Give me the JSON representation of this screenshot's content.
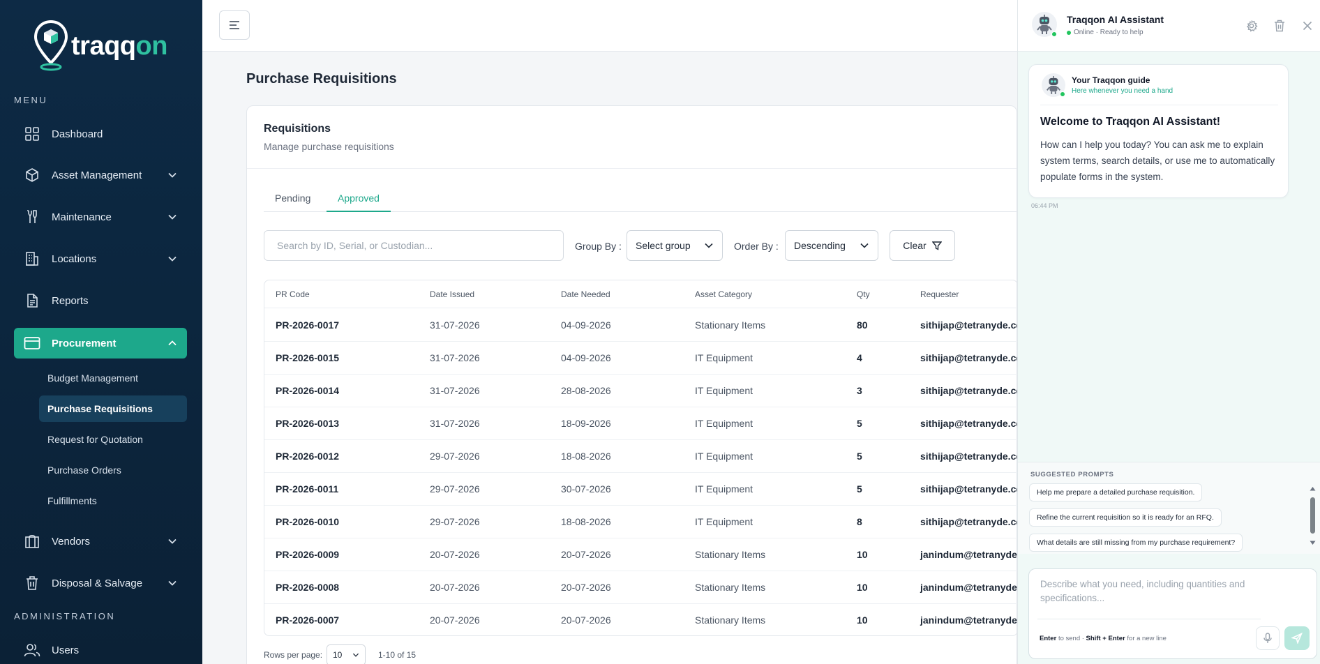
{
  "brand": {
    "name_main": "traqq",
    "name_accent": "on",
    "accent_color": "#2fc1a0",
    "sidebar_bg": "#0d2a45",
    "active_color": "#1da88b"
  },
  "sidebar": {
    "menu_label": "MENU",
    "admin_label": "ADMINISTRATION",
    "items": [
      {
        "label": "Dashboard",
        "icon": "grid-icon"
      },
      {
        "label": "Asset Management",
        "icon": "box-icon"
      },
      {
        "label": "Maintenance",
        "icon": "wrench-icon"
      },
      {
        "label": "Locations",
        "icon": "building-icon"
      },
      {
        "label": "Reports",
        "icon": "document-icon"
      },
      {
        "label": "Procurement",
        "icon": "card-icon"
      },
      {
        "label": "Vendors",
        "icon": "store-icon"
      },
      {
        "label": "Disposal & Salvage",
        "icon": "trash-icon"
      },
      {
        "label": "Users",
        "icon": "users-icon"
      }
    ],
    "procurement_sub": [
      "Budget Management",
      "Purchase Requisitions",
      "Request for Quotation",
      "Purchase Orders",
      "Fulfillments"
    ]
  },
  "page": {
    "title": "Purchase Requisitions",
    "card_title": "Requisitions",
    "card_subtitle": "Manage purchase requisitions",
    "tabs": [
      "Pending",
      "Approved"
    ],
    "active_tab": "Approved"
  },
  "filters": {
    "search_placeholder": "Search by ID, Serial, or Custodian...",
    "group_label": "Group By :",
    "group_value": "Select group",
    "order_label": "Order By :",
    "order_value": "Descending",
    "clear_label": "Clear"
  },
  "table": {
    "headers": [
      "PR Code",
      "Date Issued",
      "Date Needed",
      "Asset Category",
      "Qty",
      "Requester"
    ],
    "rows": [
      [
        "PR-2026-0017",
        "31-07-2026",
        "04-09-2026",
        "Stationary Items",
        "80",
        "sithijap@tetranyde.com"
      ],
      [
        "PR-2026-0015",
        "31-07-2026",
        "04-09-2026",
        "IT Equipment",
        "4",
        "sithijap@tetranyde.com"
      ],
      [
        "PR-2026-0014",
        "31-07-2026",
        "28-08-2026",
        "IT Equipment",
        "3",
        "sithijap@tetranyde.com"
      ],
      [
        "PR-2026-0013",
        "31-07-2026",
        "18-09-2026",
        "IT Equipment",
        "5",
        "sithijap@tetranyde.com"
      ],
      [
        "PR-2026-0012",
        "29-07-2026",
        "18-08-2026",
        "IT Equipment",
        "5",
        "sithijap@tetranyde.com"
      ],
      [
        "PR-2026-0011",
        "29-07-2026",
        "30-07-2026",
        "IT Equipment",
        "5",
        "sithijap@tetranyde.com"
      ],
      [
        "PR-2026-0010",
        "29-07-2026",
        "18-08-2026",
        "IT Equipment",
        "8",
        "sithijap@tetranyde.com"
      ],
      [
        "PR-2026-0009",
        "20-07-2026",
        "20-07-2026",
        "Stationary Items",
        "10",
        "janindum@tetranyde.com"
      ],
      [
        "PR-2026-0008",
        "20-07-2026",
        "20-07-2026",
        "Stationary Items",
        "10",
        "janindum@tetranyde.com"
      ],
      [
        "PR-2026-0007",
        "20-07-2026",
        "20-07-2026",
        "Stationary Items",
        "10",
        "janindum@tetranyde.com"
      ]
    ],
    "rows_per_page_label": "Rows per page:",
    "rows_per_page": "10",
    "range": "1-10 of 15"
  },
  "assistant": {
    "title": "Traqqon AI Assistant",
    "status": "Online · Ready to help",
    "guide_title": "Your Traqqon guide",
    "guide_subtitle": "Here whenever you need a hand",
    "welcome_title": "Welcome to Traqqon AI Assistant!",
    "welcome_body": "How can I help you today? You can ask me to explain system terms, search details, or use me to automatically populate forms in the system.",
    "time": "06:44 PM",
    "suggested_label": "SUGGESTED PROMPTS",
    "prompts": [
      "Help me prepare a detailed purchase requisition.",
      "Refine the current requisition so it is ready for an RFQ.",
      "What details are still missing from my purchase requirement?"
    ],
    "input_placeholder": "Describe what you need, including quantities and specifications...",
    "hint_enter": "Enter",
    "hint_send": "to send ·",
    "hint_shift": "Shift + Enter",
    "hint_newline": "for a new line"
  }
}
